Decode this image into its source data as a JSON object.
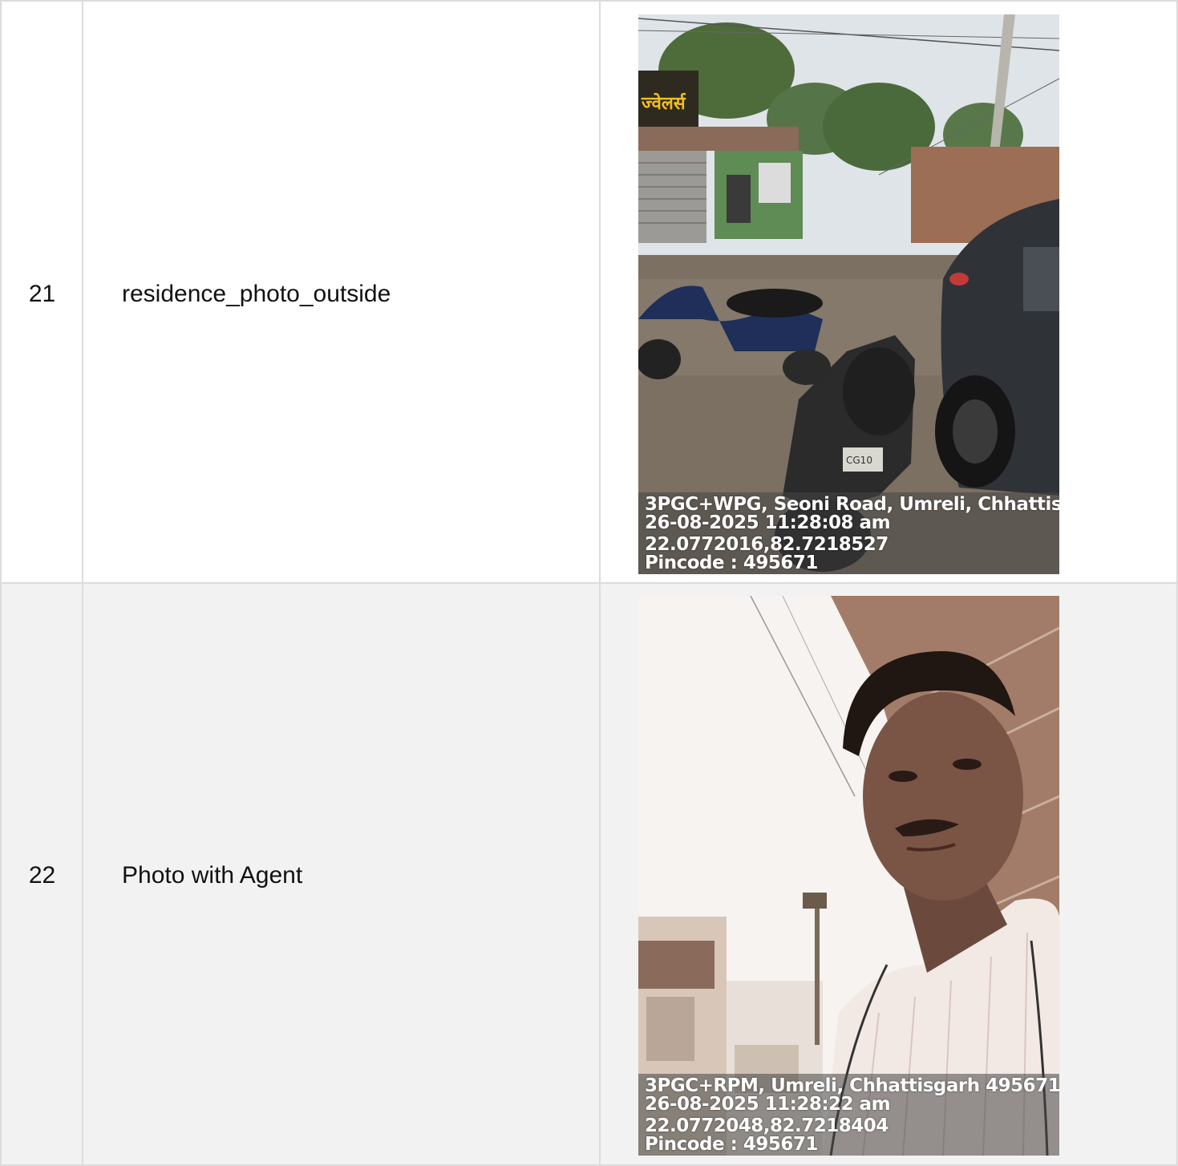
{
  "rows": [
    {
      "number": "21",
      "label": "residence_photo_outside",
      "photo": {
        "caption_lines": [
          "3PGC+WPG, Seoni Road, Umreli, Chhattis",
          "26-08-2025 11:28:08 am",
          "22.0772016,82.7218527",
          "Pincode : 495671"
        ],
        "shop_sign": "ज्वेलर्स",
        "plate": "CG10"
      }
    },
    {
      "number": "22",
      "label": "Photo with Agent",
      "photo": {
        "caption_lines": [
          "3PGC+RPM, Umreli, Chhattisgarh 495671",
          "26-08-2025 11:28:22 am",
          "22.0772048,82.7218404",
          "Pincode : 495671"
        ]
      }
    }
  ],
  "colors": {
    "border": "#dcdcdc",
    "row_alt": "#f2f2f2"
  }
}
